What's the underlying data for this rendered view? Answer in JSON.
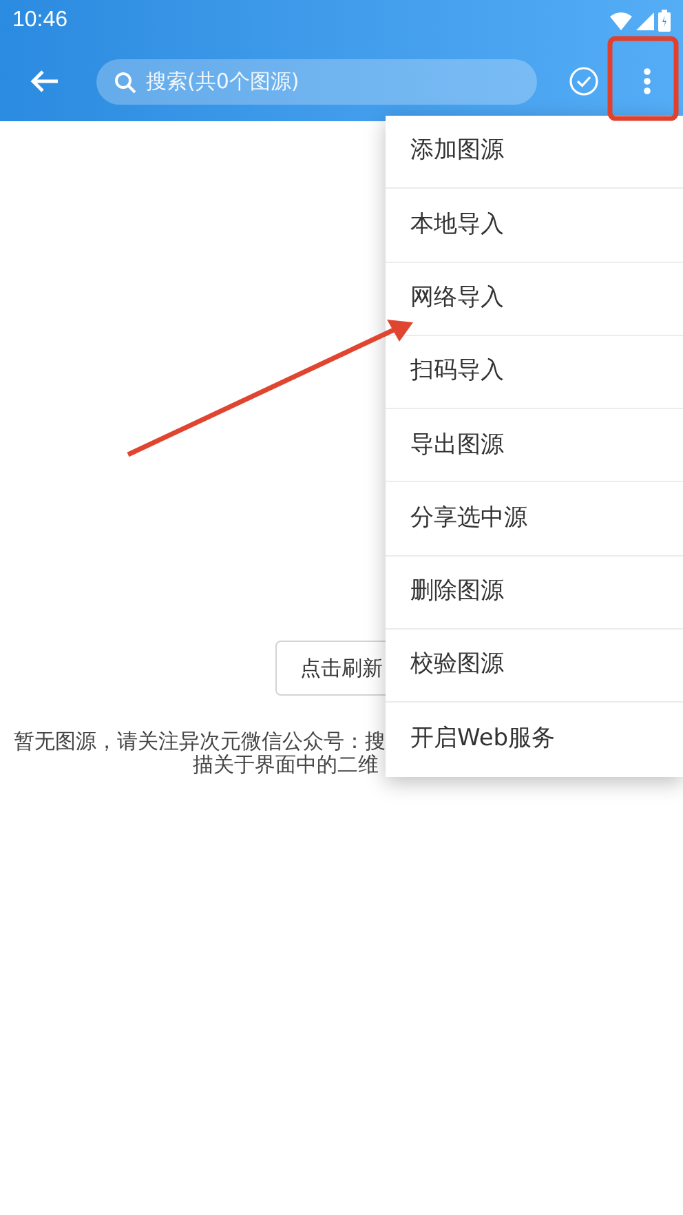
{
  "status_bar": {
    "time": "10:46"
  },
  "toolbar": {
    "search": {
      "placeholder": "搜索(共0个图源)"
    }
  },
  "empty_state": {
    "refresh_button": "点击刷新",
    "message_lines": [
      "暂无图源，请关注异次元微信公众号：搜",
      "描关于界面中的二维"
    ]
  },
  "menu": {
    "items": [
      {
        "label": "添加图源"
      },
      {
        "label": "本地导入"
      },
      {
        "label": "网络导入"
      },
      {
        "label": "扫码导入"
      },
      {
        "label": "导出图源"
      },
      {
        "label": "分享选中源"
      },
      {
        "label": "删除图源"
      },
      {
        "label": "校验图源"
      },
      {
        "label": "开启Web服务"
      }
    ]
  }
}
